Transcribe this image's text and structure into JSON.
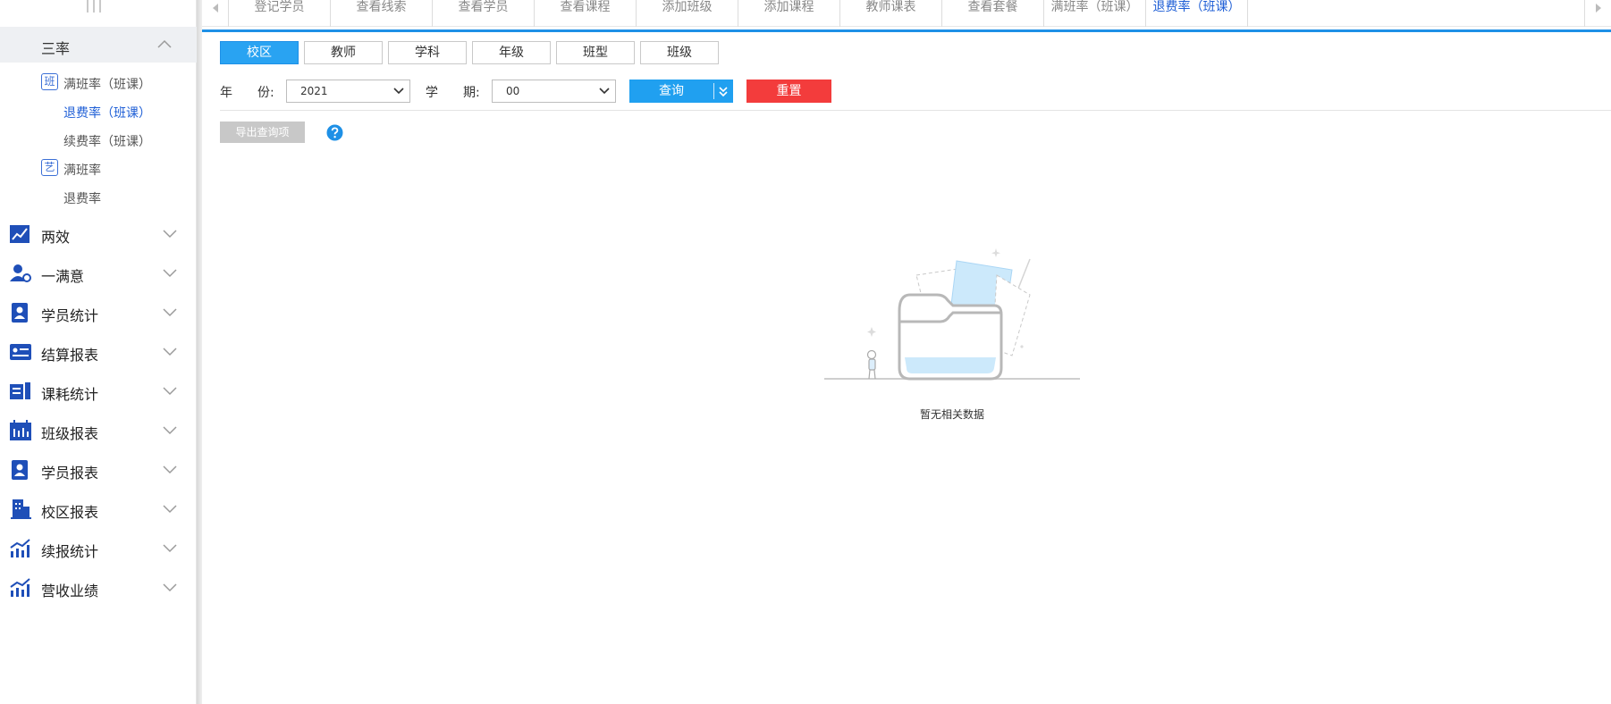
{
  "sidebar": {
    "section": {
      "title": "三率",
      "expanded": true
    },
    "sub_items": [
      {
        "badge": "班",
        "label": "满班率（班课）",
        "active": false
      },
      {
        "badge": "",
        "label": "退费率（班课）",
        "active": true
      },
      {
        "badge": "",
        "label": "续费率（班课）",
        "active": false
      },
      {
        "badge": "艺",
        "label": "满班率",
        "active": false
      },
      {
        "badge": "",
        "label": "退费率",
        "active": false
      }
    ],
    "menu": [
      {
        "icon": "chart-line-icon",
        "label": "两效"
      },
      {
        "icon": "user-gear-icon",
        "label": "一满意"
      },
      {
        "icon": "student-card-icon",
        "label": "学员统计"
      },
      {
        "icon": "id-card-icon",
        "label": "结算报表"
      },
      {
        "icon": "book-list-icon",
        "label": "课耗统计"
      },
      {
        "icon": "calendar-icon",
        "label": "班级报表"
      },
      {
        "icon": "student-report-icon",
        "label": "学员报表"
      },
      {
        "icon": "building-icon",
        "label": "校区报表"
      },
      {
        "icon": "growth-chart-icon",
        "label": "续报统计"
      },
      {
        "icon": "revenue-chart-icon",
        "label": "营收业绩"
      }
    ]
  },
  "tabs": [
    {
      "label": "登记学员",
      "active": false
    },
    {
      "label": "查看线索",
      "active": false
    },
    {
      "label": "查看学员",
      "active": false
    },
    {
      "label": "查看课程",
      "active": false
    },
    {
      "label": "添加班级",
      "active": false
    },
    {
      "label": "添加课程",
      "active": false
    },
    {
      "label": "教师课表",
      "active": false
    },
    {
      "label": "查看套餐",
      "active": false
    },
    {
      "label": "满班率（班课）",
      "active": false
    },
    {
      "label": "退费率（班课）",
      "active": true
    }
  ],
  "dimensions": [
    {
      "label": "校区",
      "active": true
    },
    {
      "label": "教师",
      "active": false
    },
    {
      "label": "学科",
      "active": false
    },
    {
      "label": "年级",
      "active": false
    },
    {
      "label": "班型",
      "active": false
    },
    {
      "label": "班级",
      "active": false
    }
  ],
  "filters": {
    "year_label_a": "年",
    "year_label_b": "份:",
    "year_value": "2021",
    "term_label_a": "学",
    "term_label_b": "期:",
    "term_value": "00"
  },
  "buttons": {
    "query": "查询",
    "reset": "重置",
    "export": "导出查询项"
  },
  "empty": {
    "text": "暂无相关数据"
  },
  "colors": {
    "accent": "#1e90e6",
    "primary_button": "#20a0f0",
    "reset_button": "#f33c3c",
    "active_link": "#1f5fd6",
    "sidebar_icon": "#1f4fb8"
  }
}
